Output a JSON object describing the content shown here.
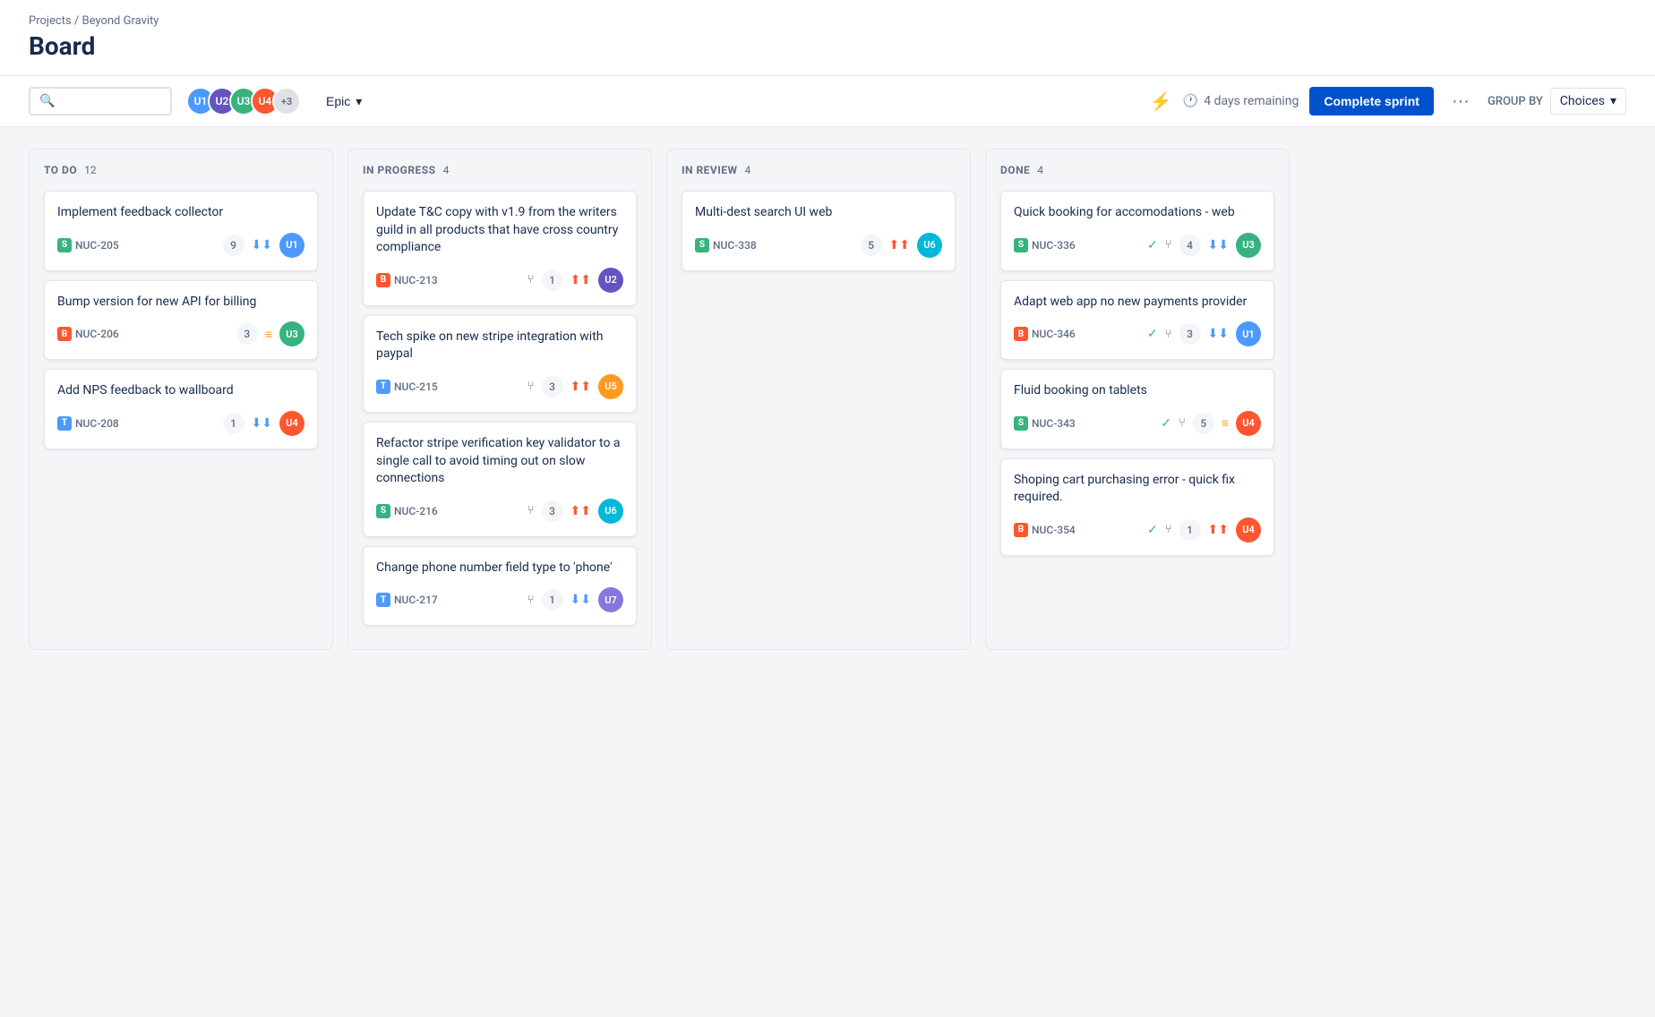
{
  "breadcrumb": "Projects / Beyond Gravity",
  "page_title": "Board",
  "search": {
    "placeholder": ""
  },
  "team": {
    "avatars": [
      "av1",
      "av2",
      "av3",
      "av4"
    ],
    "more": "+3"
  },
  "epic_label": "Epic",
  "sprint": {
    "days_remaining": "4 days remaining",
    "complete_label": "Complete sprint",
    "more_label": "···"
  },
  "group_by": {
    "label": "GROUP BY",
    "value": "Choices"
  },
  "columns": [
    {
      "id": "todo",
      "title": "TO DO",
      "count": 12,
      "cards": [
        {
          "title": "Implement feedback collector",
          "issue_key": "NUC-205",
          "issue_type": "story",
          "points": 9,
          "priority": "low",
          "avatar": "av1"
        },
        {
          "title": "Bump version for new API for billing",
          "issue_key": "NUC-206",
          "issue_type": "bug",
          "points": 3,
          "priority": "medium",
          "avatar": "av3"
        },
        {
          "title": "Add NPS feedback to wallboard",
          "issue_key": "NUC-208",
          "issue_type": "task",
          "points": 1,
          "priority": "low2",
          "avatar": "av4"
        }
      ]
    },
    {
      "id": "inprogress",
      "title": "IN PROGRESS",
      "count": 4,
      "cards": [
        {
          "title": "Update T&C copy with v1.9 from the writers guild in all products that have cross country compliance",
          "issue_key": "NUC-213",
          "issue_type": "bug",
          "points": 1,
          "priority": "high",
          "avatar": "av2"
        },
        {
          "title": "Tech spike on new stripe integration with paypal",
          "issue_key": "NUC-215",
          "issue_type": "task",
          "points": 3,
          "priority": "high",
          "avatar": "av5"
        },
        {
          "title": "Refactor stripe verification key validator to a single call to avoid timing out on slow connections",
          "issue_key": "NUC-216",
          "issue_type": "story",
          "points": 3,
          "priority": "high",
          "avatar": "av6"
        },
        {
          "title": "Change phone number field type to 'phone'",
          "issue_key": "NUC-217",
          "issue_type": "task",
          "points": 1,
          "priority": "low2",
          "avatar": "av7"
        }
      ]
    },
    {
      "id": "inreview",
      "title": "IN REVIEW",
      "count": 4,
      "cards": [
        {
          "title": "Multi-dest search UI web",
          "issue_key": "NUC-338",
          "issue_type": "story",
          "points": 5,
          "priority": "high",
          "avatar": "av6"
        }
      ]
    },
    {
      "id": "done",
      "title": "DONE",
      "count": 4,
      "cards": [
        {
          "title": "Quick booking for accomodations - web",
          "issue_key": "NUC-336",
          "issue_type": "story",
          "points": 4,
          "priority": "low",
          "has_check": true,
          "avatar": "av3"
        },
        {
          "title": "Adapt web app no new payments provider",
          "issue_key": "NUC-346",
          "issue_type": "bug",
          "points": 3,
          "priority": "low",
          "has_check": true,
          "avatar": "av1"
        },
        {
          "title": "Fluid booking on tablets",
          "issue_key": "NUC-343",
          "issue_type": "story",
          "points": 5,
          "priority": "medium",
          "has_check": true,
          "avatar": "av4"
        },
        {
          "title": "Shoping cart purchasing error - quick fix required.",
          "issue_key": "NUC-354",
          "issue_type": "bug",
          "points": 1,
          "priority": "highest",
          "has_check": true,
          "avatar": "av4"
        }
      ]
    }
  ]
}
